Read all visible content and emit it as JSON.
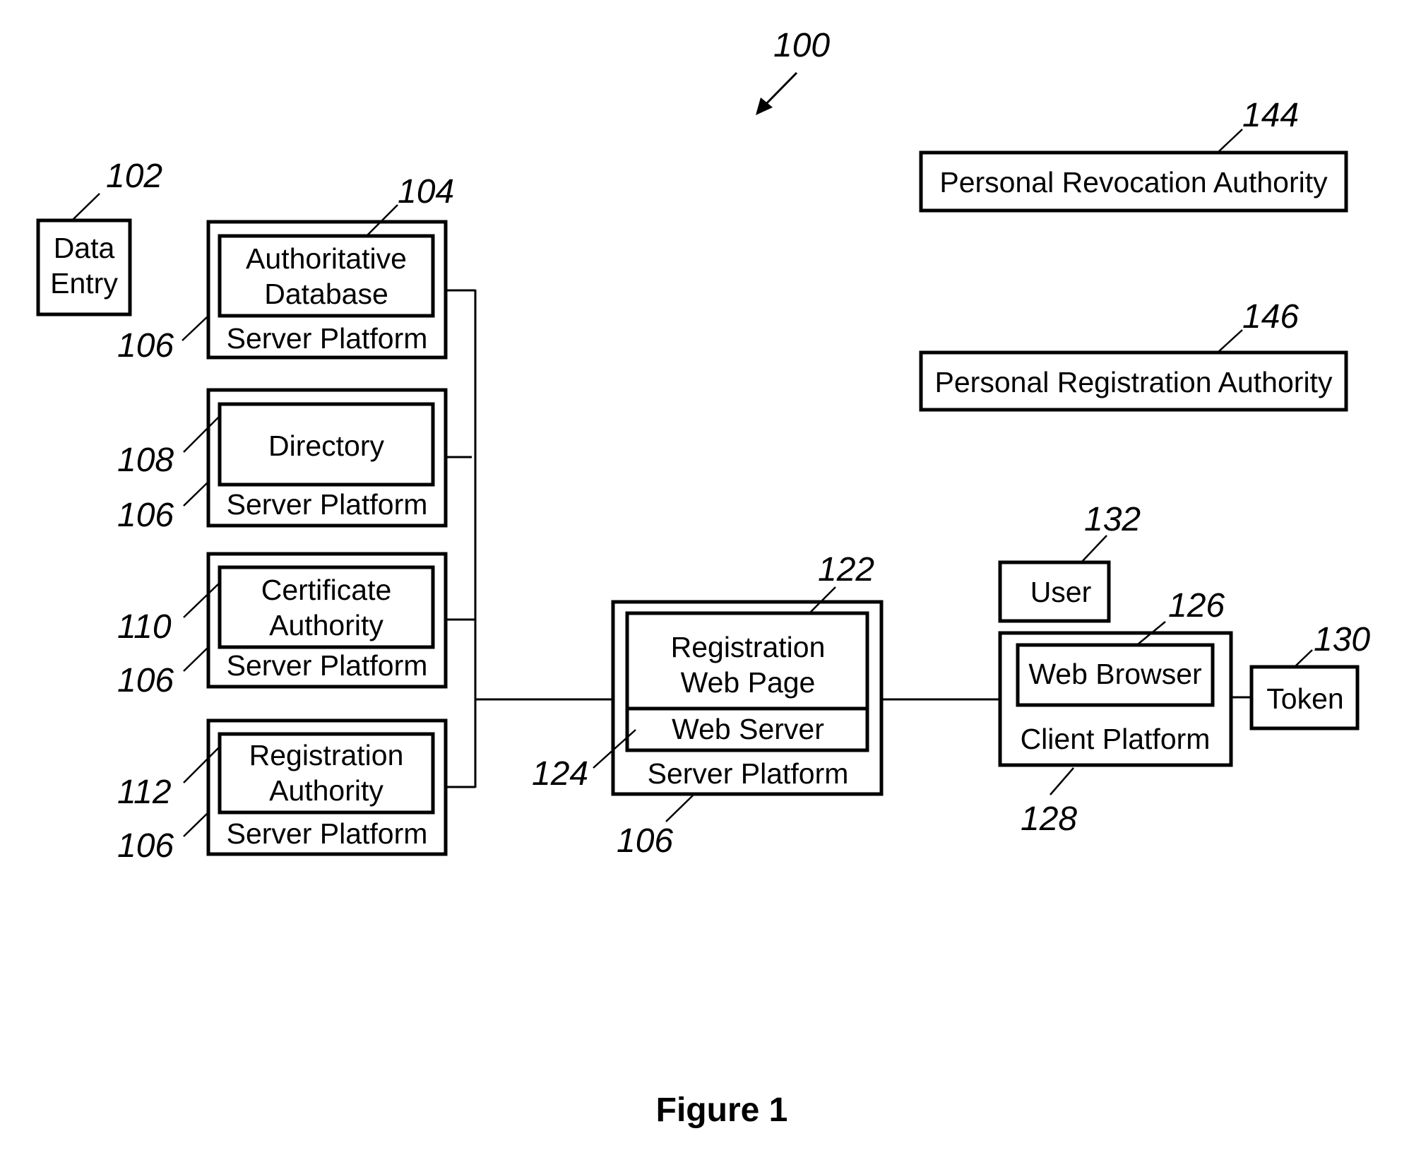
{
  "figure": {
    "caption": "Figure 1",
    "system_ref": "100"
  },
  "nodes": {
    "data_entry": {
      "lines": [
        "Data",
        "Entry"
      ],
      "ref": "102"
    },
    "auth_db_server": {
      "inner_lines": [
        "Authoritative",
        "Database"
      ],
      "inner_ref": "104",
      "platform": "Server Platform",
      "platform_ref": "106"
    },
    "directory_server": {
      "inner_lines": [
        "Directory"
      ],
      "inner_ref": "108",
      "platform": "Server Platform",
      "platform_ref": "106"
    },
    "ca_server": {
      "inner_lines": [
        "Certificate",
        "Authority"
      ],
      "inner_ref": "110",
      "platform": "Server Platform",
      "platform_ref": "106"
    },
    "ra_server": {
      "inner_lines": [
        "Registration",
        "Authority"
      ],
      "inner_ref": "112",
      "platform": "Server Platform",
      "platform_ref": "106"
    },
    "reg_web_server": {
      "page_lines": [
        "Registration",
        "Web Page"
      ],
      "page_ref": "122",
      "web_server": "Web Server",
      "web_server_ref": "124",
      "platform": "Server Platform",
      "platform_ref": "106"
    },
    "user": {
      "label": "User",
      "ref": "132"
    },
    "client": {
      "browser": "Web Browser",
      "browser_ref": "126",
      "platform": "Client Platform",
      "platform_ref": "128"
    },
    "token": {
      "label": "Token",
      "ref": "130"
    },
    "revocation_authority": {
      "label": "Personal Revocation Authority",
      "ref": "144"
    },
    "registration_authority": {
      "label": "Personal Registration Authority",
      "ref": "146"
    }
  }
}
